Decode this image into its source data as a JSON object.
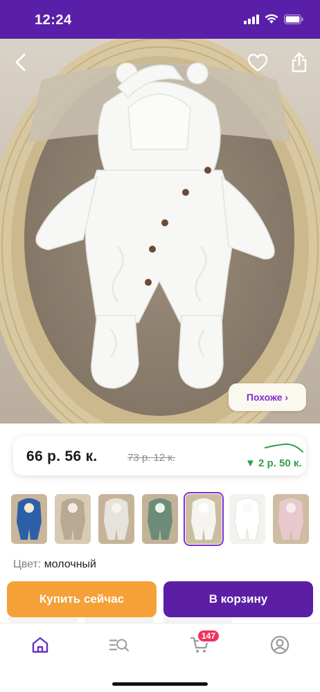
{
  "status_bar": {
    "time": "12:24",
    "icons": [
      "cellular-signal-icon",
      "wifi-icon",
      "battery-icon"
    ]
  },
  "hero": {
    "icons": [
      "back-arrow-icon",
      "heart-icon",
      "share-icon"
    ],
    "similar_label": "Похоже ›"
  },
  "price": {
    "current": "66 р.  56 к.",
    "old": "73 р.  12 к.",
    "drop": "▼ 2 р.  50 к."
  },
  "thumbnails": {
    "count": 7,
    "selected_index": 4
  },
  "color": {
    "label": "Цвет:",
    "value": "молочный"
  },
  "actions": {
    "buy_now": "Купить сейчас",
    "add_to_cart": "В корзину"
  },
  "bottom_nav": {
    "items": [
      "home-icon",
      "catalog-search-icon",
      "cart-icon",
      "profile-icon"
    ],
    "cart_badge": "147"
  },
  "colors": {
    "brand_purple": "#5b1ea5",
    "accent_orange": "#f5a137",
    "price_drop_green": "#2e9e48",
    "badge_red": "#f2315d"
  }
}
